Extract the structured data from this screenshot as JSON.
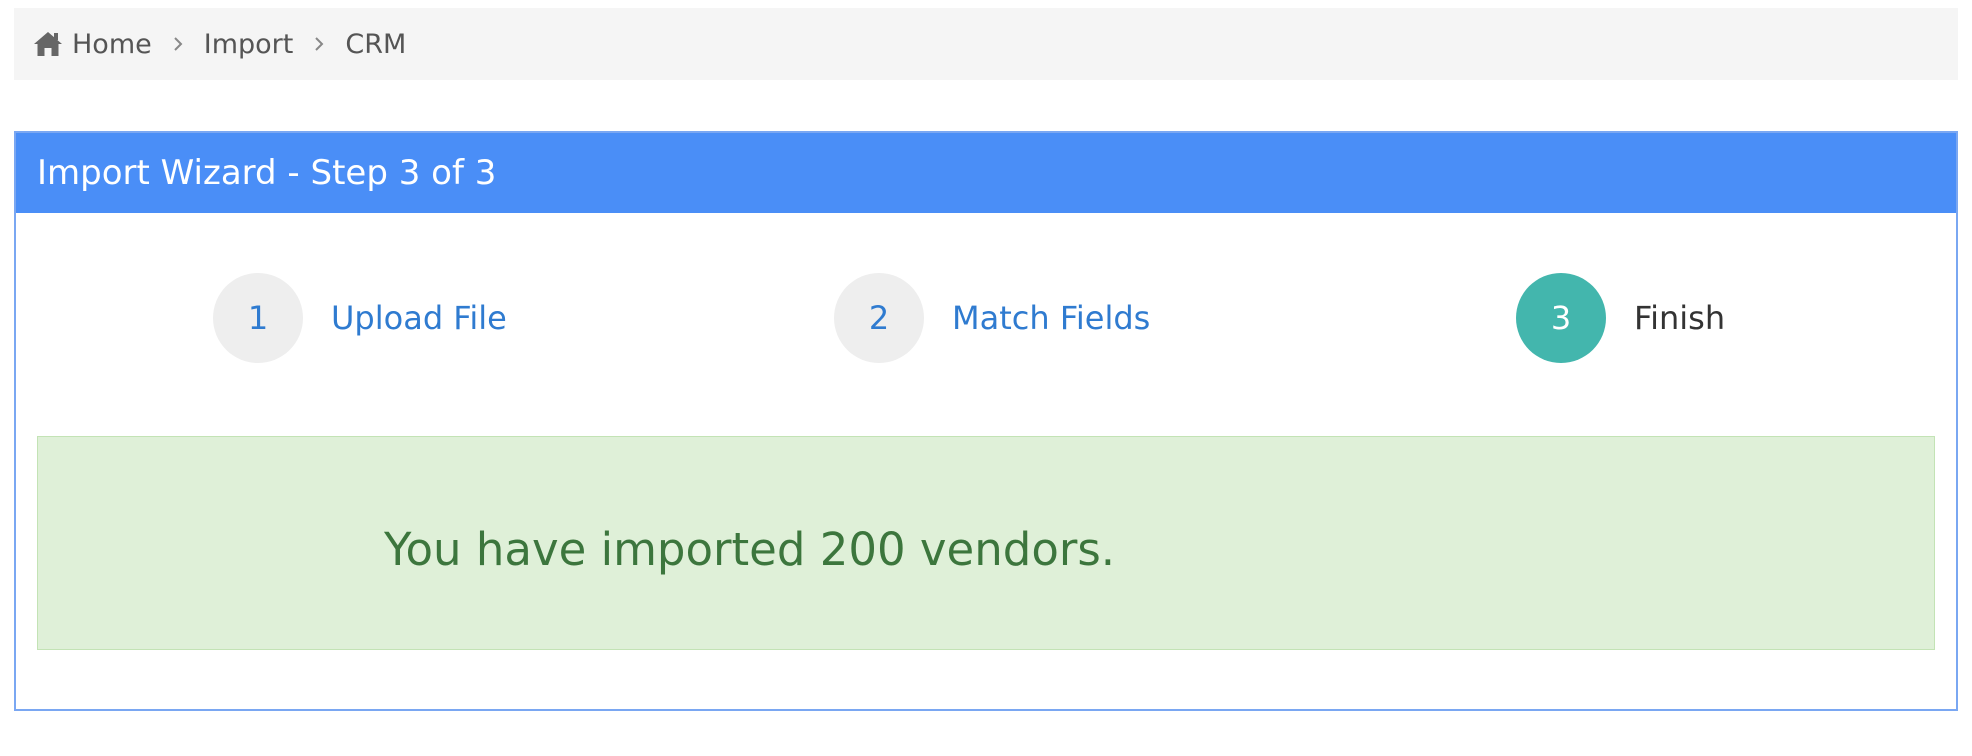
{
  "breadcrumb": {
    "items": [
      {
        "label": "Home",
        "icon": "home-icon"
      },
      {
        "label": "Import"
      },
      {
        "label": "CRM"
      }
    ],
    "separator_icon": "chevron-right-icon"
  },
  "wizard": {
    "title": "Import Wizard - Step 3 of 3",
    "steps": [
      {
        "number": "1",
        "label": "Upload File",
        "state": "completed"
      },
      {
        "number": "2",
        "label": "Match Fields",
        "state": "completed"
      },
      {
        "number": "3",
        "label": "Finish",
        "state": "current"
      }
    ],
    "current_step": 3,
    "total_steps": 3
  },
  "result": {
    "message": "You have imported 200 vendors."
  },
  "colors": {
    "header": "#4a8ef7",
    "active_step": "#43b6ad",
    "link": "#2f7bd0",
    "success_bg": "#dff0d8",
    "success_text": "#3c763d"
  }
}
